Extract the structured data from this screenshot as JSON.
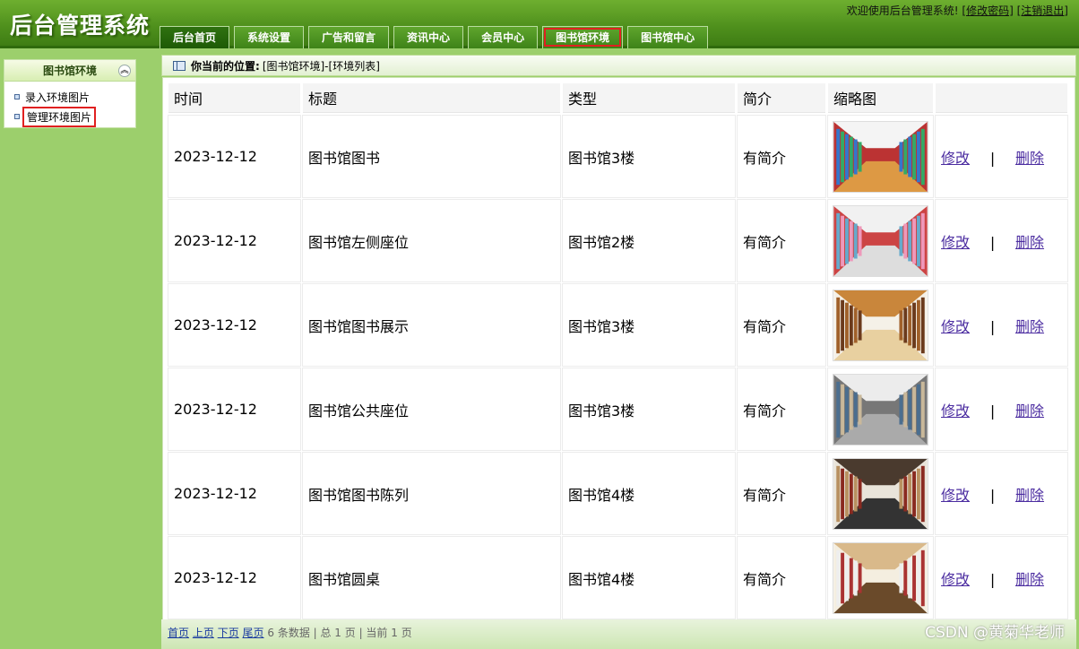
{
  "header": {
    "app_title": "后台管理系统",
    "welcome": "欢迎使用后台管理系统!",
    "change_password": "[修改密码]",
    "logout": "[注销退出]"
  },
  "nav": {
    "tabs": [
      {
        "label": "后台首页"
      },
      {
        "label": "系统设置"
      },
      {
        "label": "广告和留言"
      },
      {
        "label": "资讯中心"
      },
      {
        "label": "会员中心"
      },
      {
        "label": "图书馆环境"
      },
      {
        "label": "图书馆中心"
      }
    ],
    "active_index": 5
  },
  "sidebar": {
    "title": "图书馆环境",
    "items": [
      {
        "label": "录入环境图片"
      },
      {
        "label": "管理环境图片"
      }
    ],
    "active_index": 1
  },
  "breadcrumb": {
    "label": "你当前的位置:",
    "path": "[图书馆环境]-[环境列表]"
  },
  "table": {
    "headers": [
      "时间",
      "标题",
      "类型",
      "简介",
      "缩略图",
      ""
    ],
    "rows": [
      {
        "date": "2023-12-12",
        "title": "图书馆图书",
        "type": "图书馆3楼",
        "intro": "有简介",
        "edit": "修改",
        "sep": "|",
        "delete": "删除"
      },
      {
        "date": "2023-12-12",
        "title": "图书馆左侧座位",
        "type": "图书馆2楼",
        "intro": "有简介",
        "edit": "修改",
        "sep": "|",
        "delete": "删除"
      },
      {
        "date": "2023-12-12",
        "title": "图书馆图书展示",
        "type": "图书馆3楼",
        "intro": "有简介",
        "edit": "修改",
        "sep": "|",
        "delete": "删除"
      },
      {
        "date": "2023-12-12",
        "title": "图书馆公共座位",
        "type": "图书馆3楼",
        "intro": "有简介",
        "edit": "修改",
        "sep": "|",
        "delete": "删除"
      },
      {
        "date": "2023-12-12",
        "title": "图书馆图书陈列",
        "type": "图书馆4楼",
        "intro": "有简介",
        "edit": "修改",
        "sep": "|",
        "delete": "删除"
      },
      {
        "date": "2023-12-12",
        "title": "图书馆圆桌",
        "type": "图书馆4楼",
        "intro": "有简介",
        "edit": "修改",
        "sep": "|",
        "delete": "删除"
      }
    ]
  },
  "pager": {
    "first": "首页",
    "prev": "上页",
    "next": "下页",
    "last": "尾页",
    "info": "6 条数据 | 总 1 页 | 当前 1 页"
  },
  "watermark": "CSDN @黄菊华老师"
}
